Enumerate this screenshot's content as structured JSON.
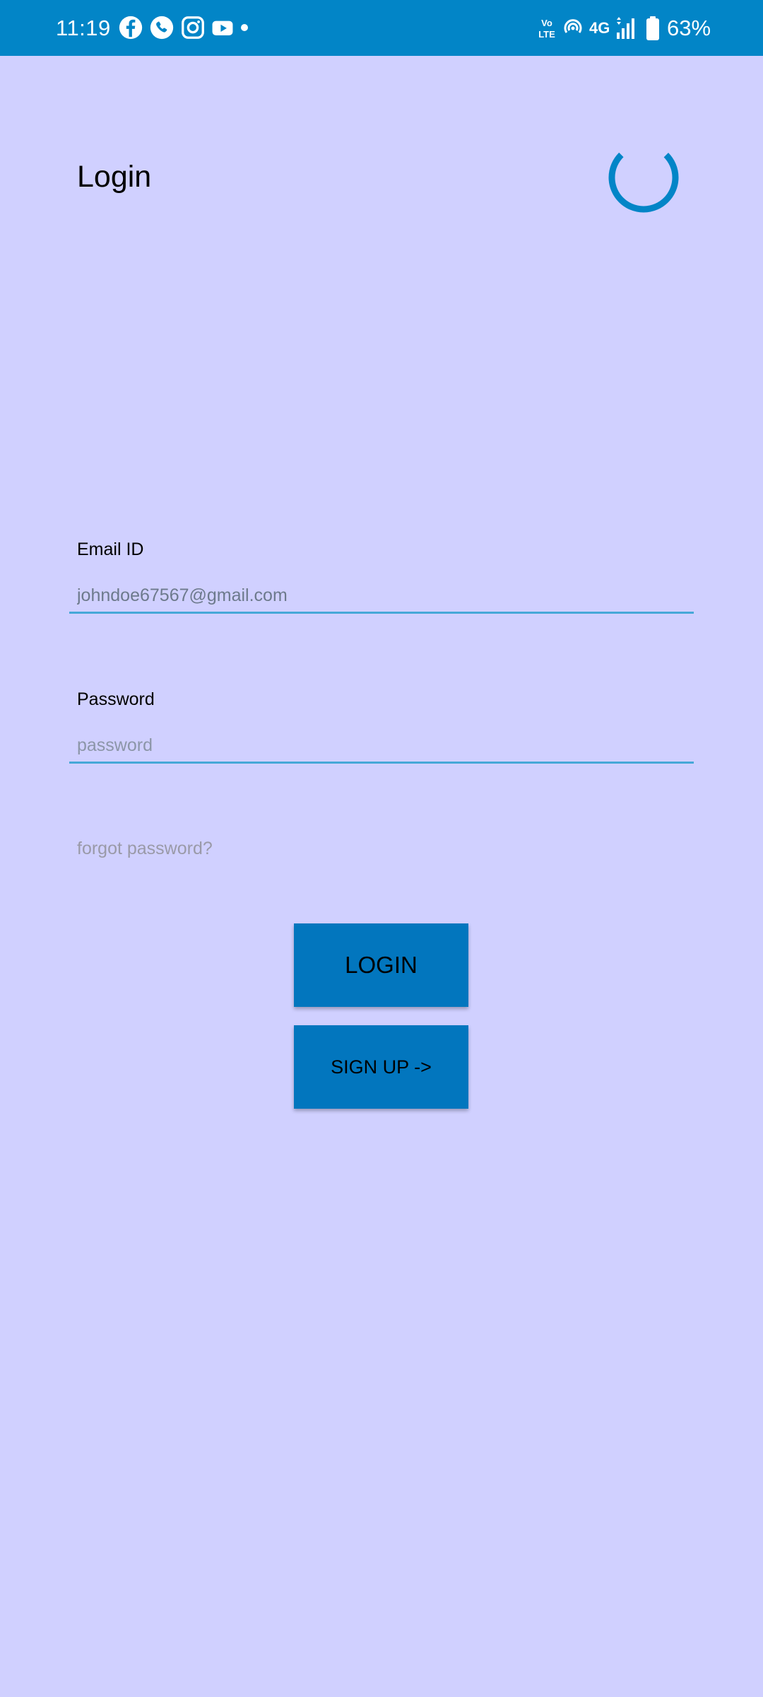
{
  "status_bar": {
    "time": "11:19",
    "left_icons": [
      "facebook-icon",
      "whatsapp-icon",
      "instagram-icon",
      "youtube-icon"
    ],
    "right_icons": [
      "volte-icon",
      "hotspot-icon",
      "signal-icon",
      "battery-icon"
    ],
    "network": "4G",
    "battery": "63%",
    "volte_line1": "Vo",
    "volte_line2": "LTE",
    "background_color": "#0285c7"
  },
  "header": {
    "title": "Login",
    "spinner_color": "#0285c7"
  },
  "form": {
    "email_label": "Email ID",
    "email_value": "johndoe67567@gmail.com",
    "password_label": "Password",
    "password_placeholder": "password",
    "forgot_password": "forgot password?"
  },
  "buttons": {
    "login": "LOGIN",
    "signup": "SIGN UP ->",
    "button_color": "#0276be"
  },
  "colors": {
    "background": "#d0d0ff",
    "input_underline": "#46a8d8"
  }
}
